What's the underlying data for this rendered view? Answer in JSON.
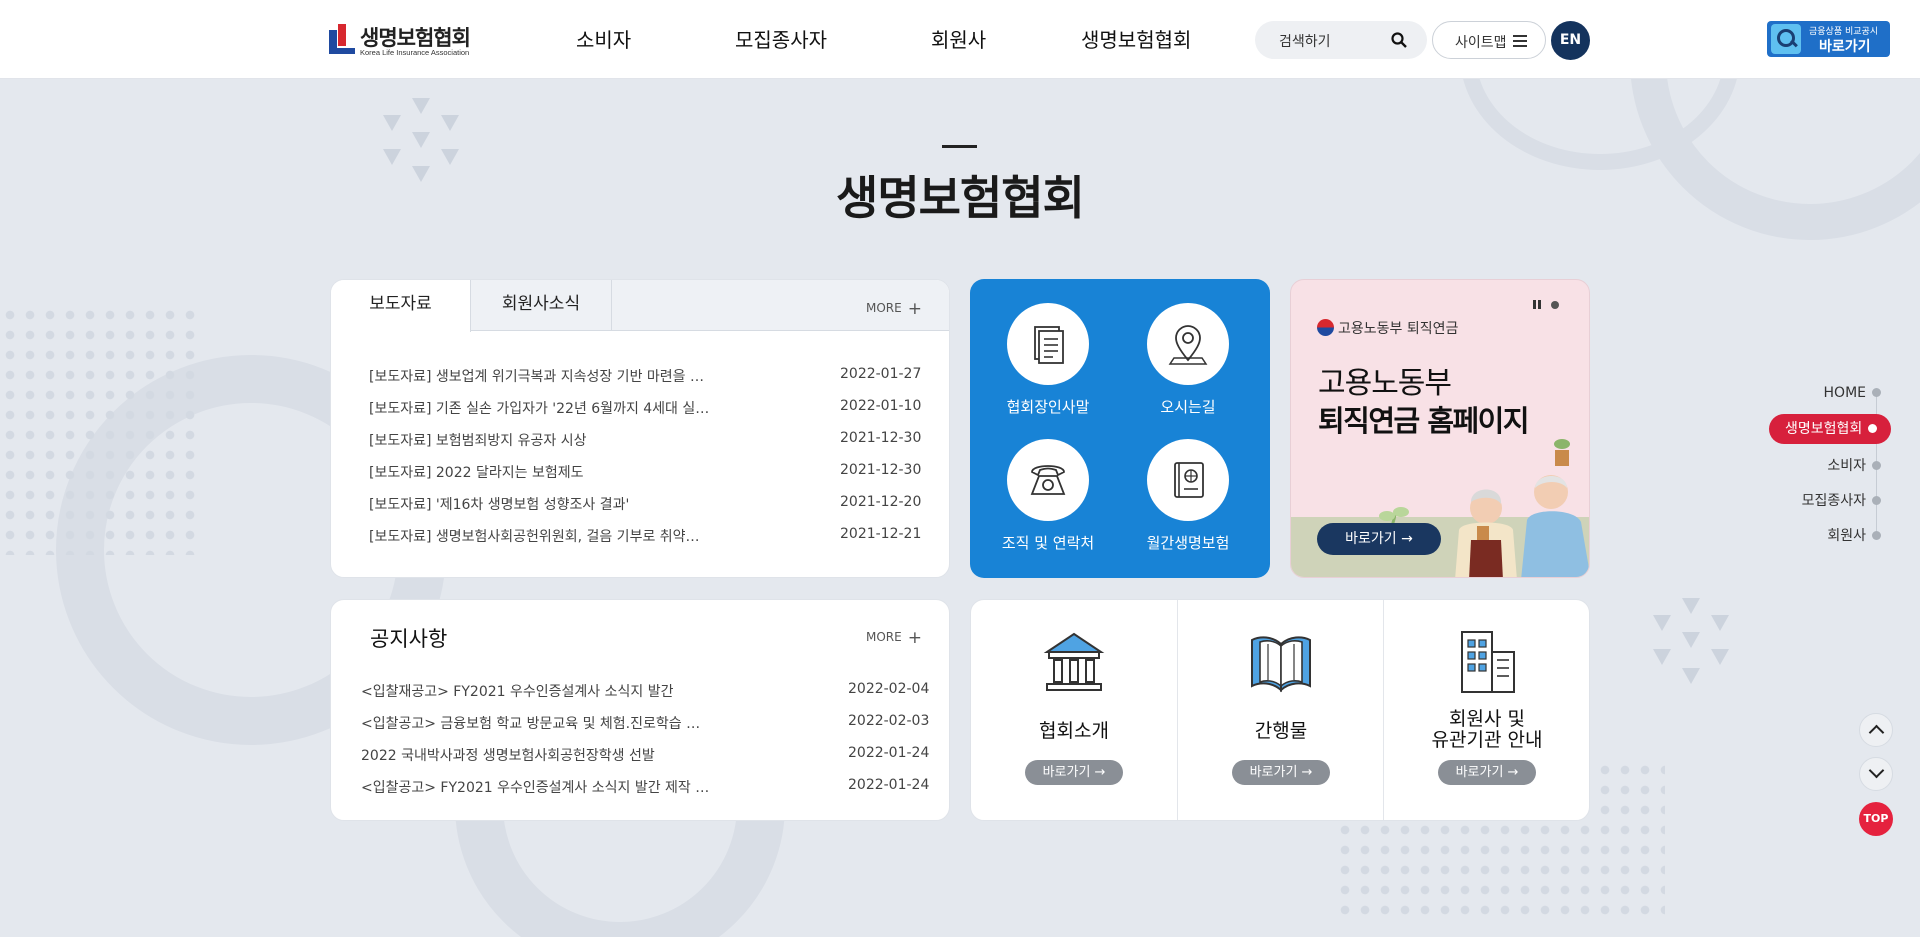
{
  "header": {
    "logo_kr": "생명보험협회",
    "logo_en": "Korea Life Insurance Association",
    "nav": [
      "소비자",
      "모집종사자",
      "회원사",
      "생명보험협회"
    ],
    "search_label": "검색하기",
    "sitemap_label": "사이트맵",
    "lang_label": "EN",
    "compare_small": "금융상품 비교공시",
    "compare_big": "바로가기"
  },
  "page_title": "생명보험협회",
  "press": {
    "tabs": [
      "보도자료",
      "회원사소식"
    ],
    "more": "MORE",
    "rows": [
      {
        "title": "[보도자료] 생보업계 위기극복과 지속성장 기반 마련을 …",
        "date": "2022-01-27"
      },
      {
        "title": "[보도자료] 기존 실손 가입자가 '22년 6월까지 4세대 실…",
        "date": "2022-01-10"
      },
      {
        "title": "[보도자료] 보험범죄방지 유공자 시상",
        "date": "2021-12-30"
      },
      {
        "title": "[보도자료] 2022 달라지는 보험제도",
        "date": "2021-12-30"
      },
      {
        "title": "[보도자료] '제16차 생명보험 성향조사 결과'",
        "date": "2021-12-20"
      },
      {
        "title": "[보도자료] 생명보험사회공헌위원회, 걸음 기부로 취약…",
        "date": "2021-12-21"
      }
    ]
  },
  "notice": {
    "title": "공지사항",
    "more": "MORE",
    "rows": [
      {
        "title": "<입찰재공고> FY2021 우수인증설계사 소식지 발간",
        "date": "2022-02-04"
      },
      {
        "title": "<입찰공고> 금융보험 학교 방문교육 및 체험.진로학습 …",
        "date": "2022-02-03"
      },
      {
        "title": "2022 국내박사과정 생명보험사회공헌장학생 선발",
        "date": "2022-01-24"
      },
      {
        "title": "<입찰공고> FY2021 우수인증설계사 소식지 발간 제작 …",
        "date": "2022-01-24"
      }
    ]
  },
  "quick": [
    {
      "label": "협회장인사말",
      "icon": "document-icon"
    },
    {
      "label": "오시는길",
      "icon": "map-pin-icon"
    },
    {
      "label": "조직 및 연락처",
      "icon": "telephone-icon"
    },
    {
      "label": "월간생명보험",
      "icon": "magazine-icon"
    }
  ],
  "banner": {
    "ministry": "고용노동부 퇴직연금",
    "line1": "고용노동부",
    "line2": "퇴직연금 홈페이지",
    "button": "바로가기 →"
  },
  "intro": [
    {
      "label": "협회소개",
      "button": "바로가기 →",
      "icon": "building-icon"
    },
    {
      "label": "간행물",
      "button": "바로가기 →",
      "icon": "book-icon"
    },
    {
      "label": "회원사 및\n유관기관 안내",
      "button": "바로가기 →",
      "icon": "office-icon"
    }
  ],
  "side_nav": {
    "home": "HOME",
    "active": "생명보험협회",
    "items": [
      "소비자",
      "모집종사자",
      "회원사"
    ]
  },
  "top_label": "TOP",
  "colors": {
    "brand_blue": "#1883d6",
    "navy": "#14335d",
    "accent_red": "#d7203c",
    "background": "#e4e8ee"
  }
}
